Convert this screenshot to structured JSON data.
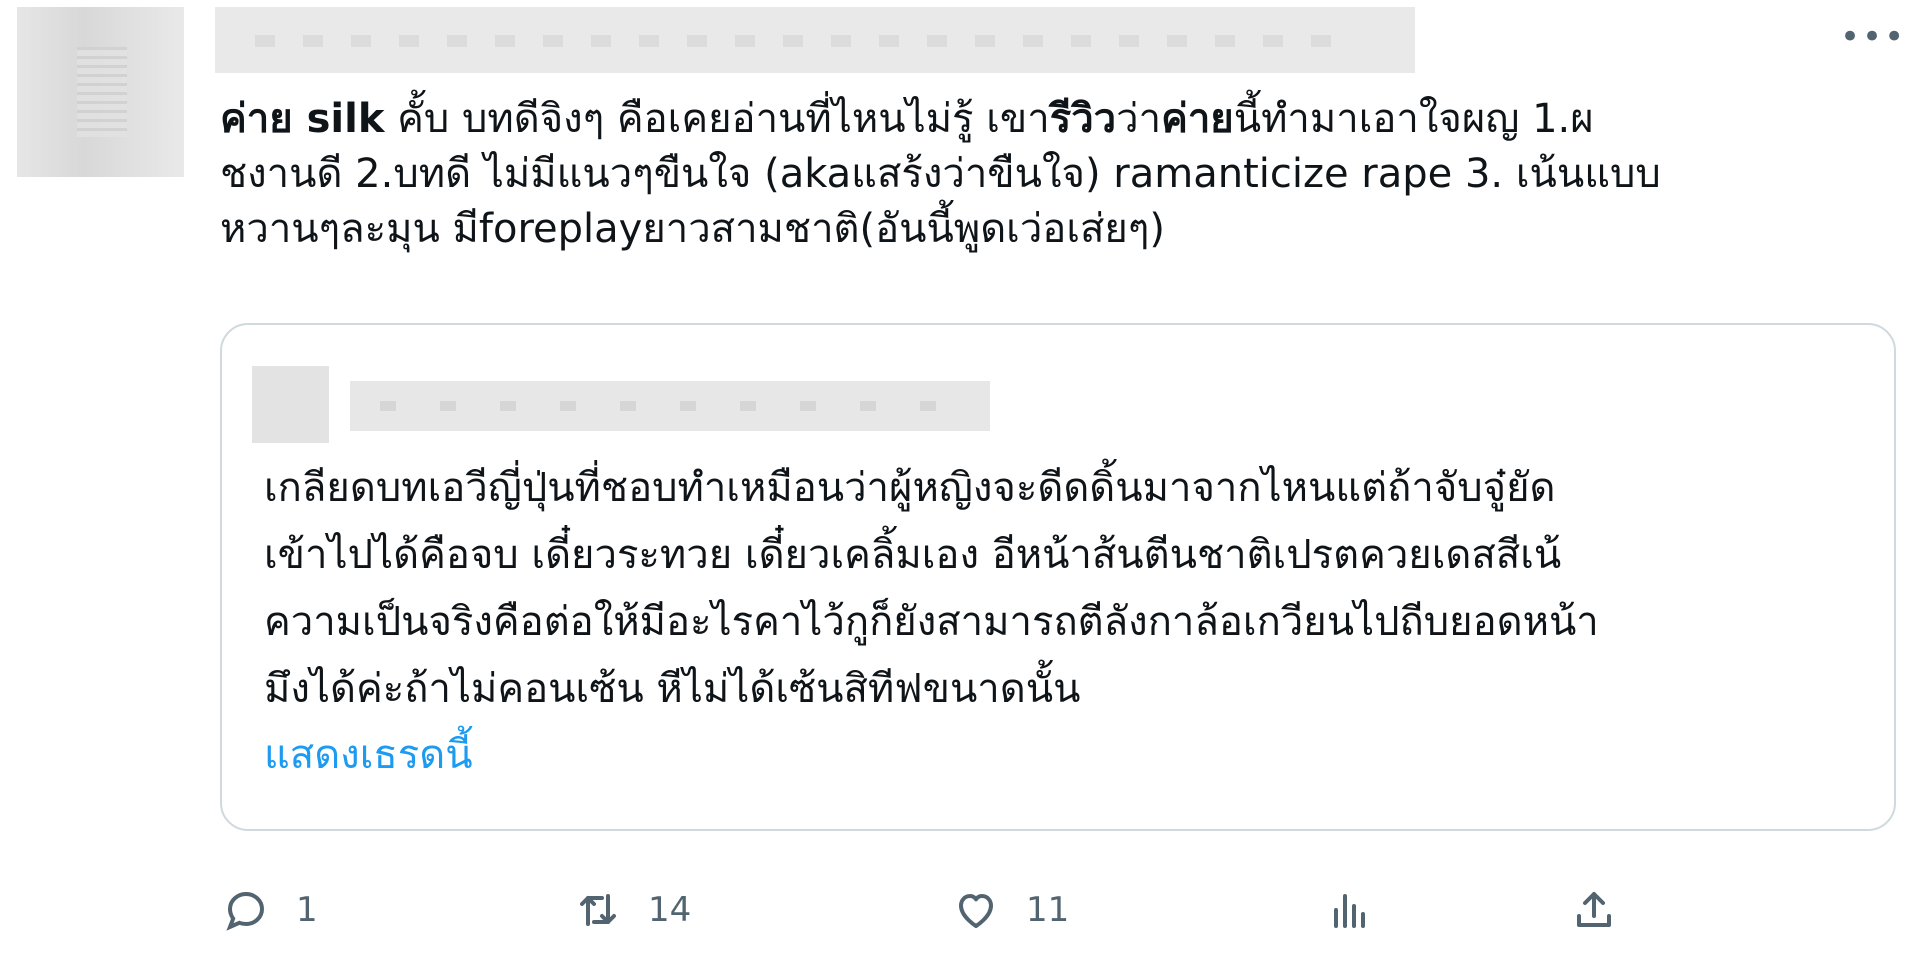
{
  "tweet": {
    "text_runs": [
      {
        "text": "ค่าย silk",
        "bold": true
      },
      {
        "text": " คั้บ บทดีจิงๆ คือเคยอ่านที่ไหนไม่รู้ เขา",
        "bold": false
      },
      {
        "text": "รีวิว",
        "bold": true
      },
      {
        "text": "ว่า",
        "bold": false
      },
      {
        "text": "ค่าย",
        "bold": true
      },
      {
        "text": "นี้ทำมาเอาใจผญ 1.ผ\nชงานดี 2.บทดี ไม่มีแนวๆขืนใจ (akaแสร้งว่าขืนใจ) ramanticize rape 3. เน้นแบบ\nหวานๆละมุน มีforeplayยาวสามชาติ(อันนี้พูดเว่อเส่ยๆ)",
        "bold": false
      }
    ],
    "more_label": "•••"
  },
  "quote": {
    "text": "เกลียดบทเอวีญี่ปุ่นที่ชอบทำเหมือนว่าผู้หญิงจะดีดดิ้นมาจากไหนแต่ถ้าจับจู๋ยัด\nเข้าไปได้คือจบ เดี๋ยวระทวย เดี๋ยวเคลิ้มเอง อีหน้าส้นตีนชาติเปรตควยเดสสีเน้\nความเป็นจริงคือต่อให้มีอะไรคาไว้กูก็ยังสามารถตีลังกาล้อเกวียนไปถีบยอดหน้า\nมึงได้ค่ะถ้าไม่คอนเซ้น หีไม่ได้เซ้นสิทีฟขนาดนั้น",
    "show_thread": "แสดงเธรดนี้"
  },
  "actions": {
    "reply_count": "1",
    "retweet_count": "14",
    "like_count": "11"
  },
  "colors": {
    "text": "#0f1419",
    "muted": "#536471",
    "link": "#1d9bf0",
    "border": "#cfd9de"
  }
}
